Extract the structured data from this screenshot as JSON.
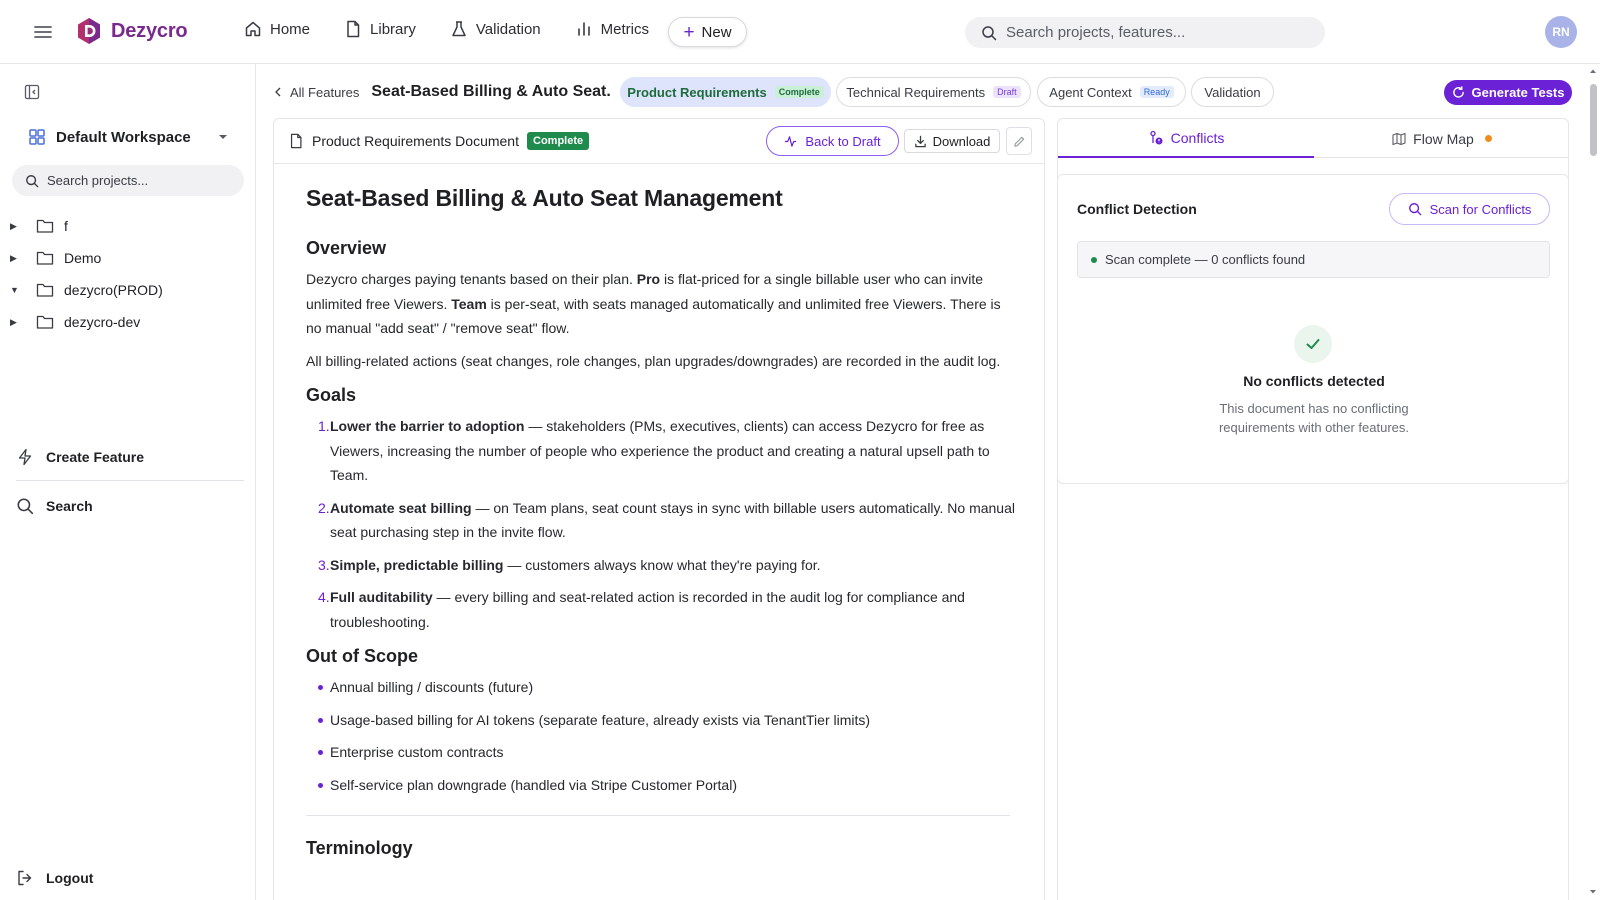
{
  "app": {
    "name": "Dezycro",
    "brand_color": "#7a2a8c",
    "accent": "#6b21d6"
  },
  "nav": {
    "items": [
      {
        "label": "Home",
        "icon": "home-icon"
      },
      {
        "label": "Library",
        "icon": "document-icon"
      },
      {
        "label": "Validation",
        "icon": "flask-icon"
      },
      {
        "label": "Metrics",
        "icon": "bar-chart-icon"
      }
    ],
    "new_label": "New"
  },
  "top_search": {
    "placeholder": "Search projects, features..."
  },
  "user": {
    "initials": "RN"
  },
  "sidebar": {
    "workspace": "Default Workspace",
    "search_placeholder": "Search projects...",
    "projects": [
      {
        "label": "f",
        "expanded": false
      },
      {
        "label": "Demo",
        "expanded": false
      },
      {
        "label": "dezycro(PROD)",
        "expanded": true
      },
      {
        "label": "dezycro-dev",
        "expanded": false
      }
    ],
    "create_feature": "Create Feature",
    "search": "Search",
    "logout": "Logout"
  },
  "breadcrumb": {
    "back": "All Features",
    "title": "Seat-Based Billing & Auto Seat..."
  },
  "doc_tabs": [
    {
      "label": "Product Requirements",
      "badge": "Complete",
      "active": true
    },
    {
      "label": "Technical Requirements",
      "badge": "Draft",
      "active": false
    },
    {
      "label": "Agent Context",
      "badge": "Ready",
      "active": false
    },
    {
      "label": "Validation",
      "badge": "",
      "active": false
    }
  ],
  "generate_tests": "Generate Tests",
  "doc": {
    "header_title": "Product Requirements Document",
    "header_badge": "Complete",
    "back_to_draft": "Back to Draft",
    "download": "Download",
    "title": "Seat-Based Billing & Auto Seat Management",
    "overview_heading": "Overview",
    "overview_p1": {
      "a": "Dezycro charges paying tenants based on their plan. ",
      "b": "Pro",
      "c": " is flat-priced for a single billable user who can invite unlimited free Viewers. ",
      "d": "Team",
      "e": " is per-seat, with seats managed automatically and unlimited free Viewers. There is no manual \"add seat\" / \"remove seat\" flow."
    },
    "overview_p2": "All billing-related actions (seat changes, role changes, plan upgrades/downgrades) are recorded in the audit log.",
    "goals_heading": "Goals",
    "goals": [
      {
        "num": "1.",
        "title": "Lower the barrier to adoption",
        "text": " — stakeholders (PMs, executives, clients) can access Dezycro for free as Viewers, increasing the number of people who experience the product and creating a natural upsell path to Team."
      },
      {
        "num": "2.",
        "title": "Automate seat billing",
        "text": " — on Team plans, seat count stays in sync with billable users automatically. No manual seat purchasing step in the invite flow."
      },
      {
        "num": "3.",
        "title": "Simple, predictable billing",
        "text": " — customers always know what they're paying for."
      },
      {
        "num": "4.",
        "title": "Full auditability",
        "text": " — every billing and seat-related action is recorded in the audit log for compliance and troubleshooting."
      }
    ],
    "out_of_scope_heading": "Out of Scope",
    "out_of_scope": [
      "Annual billing / discounts (future)",
      "Usage-based billing for AI tokens (separate feature, already exists via TenantTier limits)",
      "Enterprise custom contracts",
      "Self-service plan downgrade (handled via Stripe Customer Portal)"
    ],
    "terminology_heading": "Terminology"
  },
  "right_panel": {
    "tabs": [
      {
        "label": "Conflicts",
        "active": true
      },
      {
        "label": "Flow Map",
        "active": false
      }
    ],
    "conflict_title": "Conflict Detection",
    "scan_button": "Scan for Conflicts",
    "scan_status": "Scan complete — 0 conflicts found",
    "no_conflicts_title": "No conflicts detected",
    "no_conflicts_desc": "This document has no conflicting requirements with other features."
  }
}
